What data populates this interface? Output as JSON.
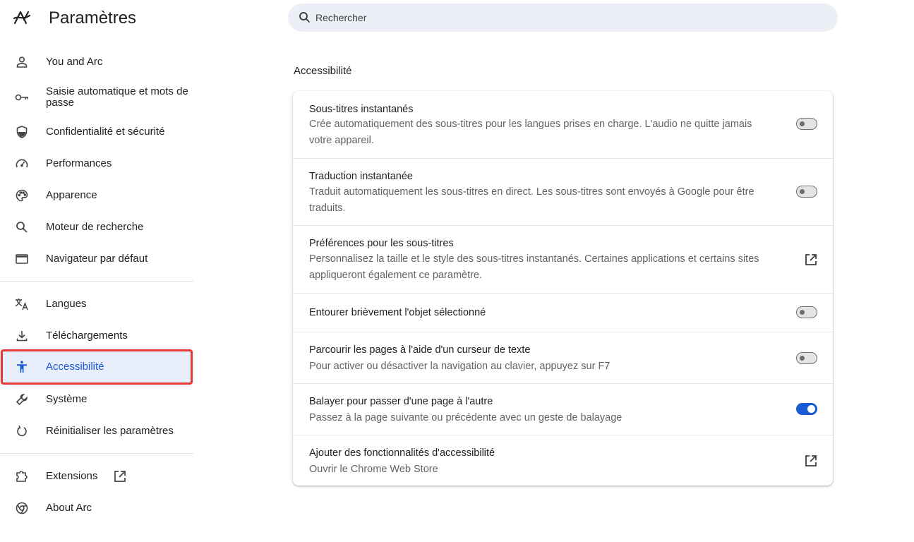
{
  "app": {
    "title": "Paramètres"
  },
  "sidebar": {
    "items": [
      {
        "label": "You and Arc",
        "icon": "person-icon"
      },
      {
        "label": "Saisie automatique et mots de passe",
        "icon": "key-icon"
      },
      {
        "label": "Confidentialité et sécurité",
        "icon": "shield-icon"
      },
      {
        "label": "Performances",
        "icon": "speedometer-icon"
      },
      {
        "label": "Apparence",
        "icon": "palette-icon"
      },
      {
        "label": "Moteur de recherche",
        "icon": "search-icon"
      },
      {
        "label": "Navigateur par défaut",
        "icon": "browser-window-icon"
      },
      {
        "label": "Langues",
        "icon": "translate-icon"
      },
      {
        "label": "Téléchargements",
        "icon": "download-icon"
      },
      {
        "label": "Accessibilité",
        "icon": "accessibility-icon",
        "active": true
      },
      {
        "label": "Système",
        "icon": "wrench-icon"
      },
      {
        "label": "Réinitialiser les paramètres",
        "icon": "reset-icon"
      },
      {
        "label": "Extensions",
        "icon": "puzzle-icon"
      },
      {
        "label": "About Arc",
        "icon": "chrome-icon"
      }
    ]
  },
  "search": {
    "placeholder": "Rechercher"
  },
  "section": {
    "title": "Accessibilité"
  },
  "settings": [
    {
      "title": "Sous-titres instantanés",
      "desc": "Crée automatiquement des sous-titres pour les langues prises en charge. L'audio ne quitte jamais votre appareil.",
      "control": "toggle",
      "on": false
    },
    {
      "title": "Traduction instantanée",
      "desc": "Traduit automatiquement les sous-titres en direct. Les sous-titres sont envoyés à Google pour être traduits.",
      "control": "toggle",
      "on": false
    },
    {
      "title": "Préférences pour les sous-titres",
      "desc": "Personnalisez la taille et le style des sous-titres instantanés. Certaines applications et certains sites appliqueront également ce paramètre.",
      "control": "external-link"
    },
    {
      "title": "Entourer brièvement l'objet sélectionné",
      "desc": "",
      "control": "toggle",
      "on": false
    },
    {
      "title": "Parcourir les pages à l'aide d'un curseur de texte",
      "desc": "Pour activer ou désactiver la navigation au clavier, appuyez sur F7",
      "control": "toggle",
      "on": false
    },
    {
      "title": "Balayer pour passer d'une page à l'autre",
      "desc": "Passez à la page suivante ou précédente avec un geste de balayage",
      "control": "toggle",
      "on": true
    },
    {
      "title": "Ajouter des fonctionnalités d'accessibilité",
      "desc": "Ouvrir le Chrome Web Store",
      "control": "external-link"
    }
  ],
  "colors": {
    "accent": "#1a5bd4",
    "active_bg": "#e8eef9",
    "highlight": "#e53935"
  }
}
